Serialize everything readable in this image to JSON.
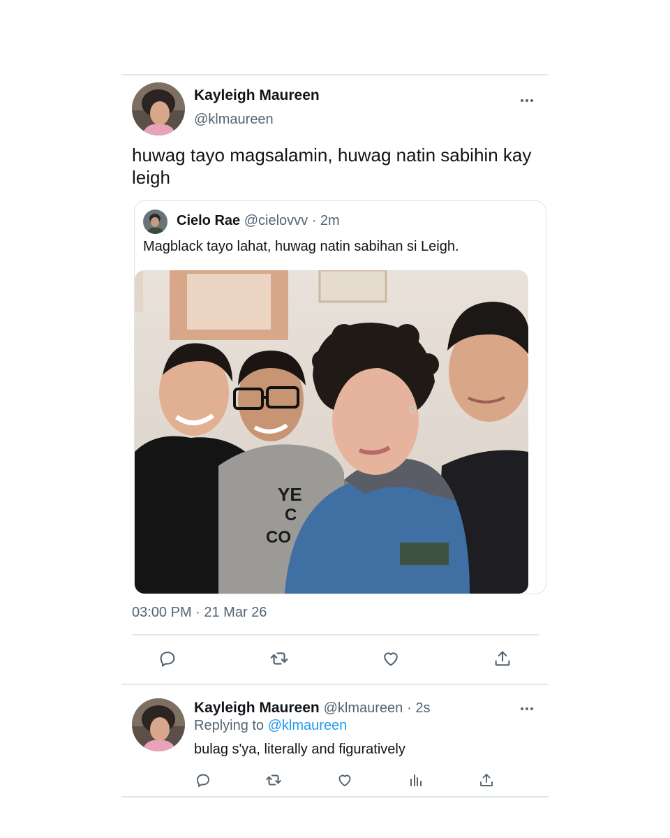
{
  "tweet": {
    "author_name": "Kayleigh Maureen",
    "author_handle": "@klmaureen",
    "text": "huwag tayo magsalamin, huwag natin sabihin kay leigh",
    "timestamp": "03:00 PM · 21 Mar 26"
  },
  "quoted_tweet": {
    "author_name": "Cielo Rae",
    "author_handle": "@cielovvv",
    "time": "· 2m",
    "text": "Magblack tayo lahat, huwag natin sabihan si Leigh.",
    "photo_shirt_text": [
      "YE",
      "C",
      "CO"
    ]
  },
  "actions": {
    "icons": [
      "reply-icon",
      "retweet-icon",
      "like-icon",
      "share-icon"
    ]
  },
  "reply": {
    "author_name": "Kayleigh Maureen",
    "author_handle": "@klmaureen",
    "time": "· 2s",
    "replying_prefix": "Replying to",
    "replying_mention": "@klmaureen",
    "text": "bulag s'ya, literally and figuratively",
    "icons": [
      "reply-icon",
      "retweet-icon",
      "like-icon",
      "analytics-icon",
      "share-icon"
    ]
  },
  "colors": {
    "text_primary": "#0f1419",
    "text_secondary": "#536471",
    "link": "#1d9bf0",
    "divider": "#e1e5e8"
  }
}
